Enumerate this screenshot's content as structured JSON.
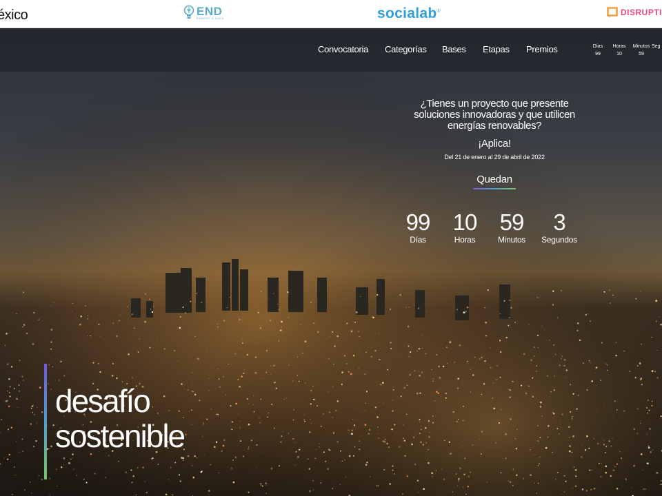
{
  "partners": {
    "mexico": "éxico",
    "end": {
      "name": "END",
      "tagline": "ENERGY & DATA"
    },
    "socialab": {
      "name": "socialab",
      "mark": "®"
    },
    "disruptivo": {
      "name": "DISRUPTIV"
    }
  },
  "nav": {
    "links": [
      "Convocatoria",
      "Categorías",
      "Bases",
      "Etapas",
      "Premios"
    ],
    "mini_countdown": [
      {
        "label": "Días",
        "value": "99"
      },
      {
        "label": "Horas",
        "value": "10"
      },
      {
        "label": "Minutos",
        "value": "59"
      },
      {
        "label": "Seg",
        "value": ""
      }
    ]
  },
  "hero": {
    "question_lines": [
      "¿Tienes un proyecto que presente",
      "soluciones innovadoras y que utilicen",
      "energías renovables?"
    ],
    "cta": "¡Aplica!",
    "dates": "Del 21 de enero al 29 de abril de 2022",
    "remaining_label": "Quedan",
    "countdown": [
      {
        "value": "99",
        "label": "Días"
      },
      {
        "value": "10",
        "label": "Horas"
      },
      {
        "value": "59",
        "label": "Minutos"
      },
      {
        "value": "3",
        "label": "Segundos"
      }
    ],
    "title_lines": [
      "desafío",
      "sostenible"
    ]
  },
  "colors": {
    "socialab": "#2f9fd8",
    "end": "#5aa9c9",
    "disruptivo": "#e84a7a",
    "accent_gradient": [
      "#6f5bd8",
      "#4e9fcf",
      "#7cc36a"
    ]
  }
}
